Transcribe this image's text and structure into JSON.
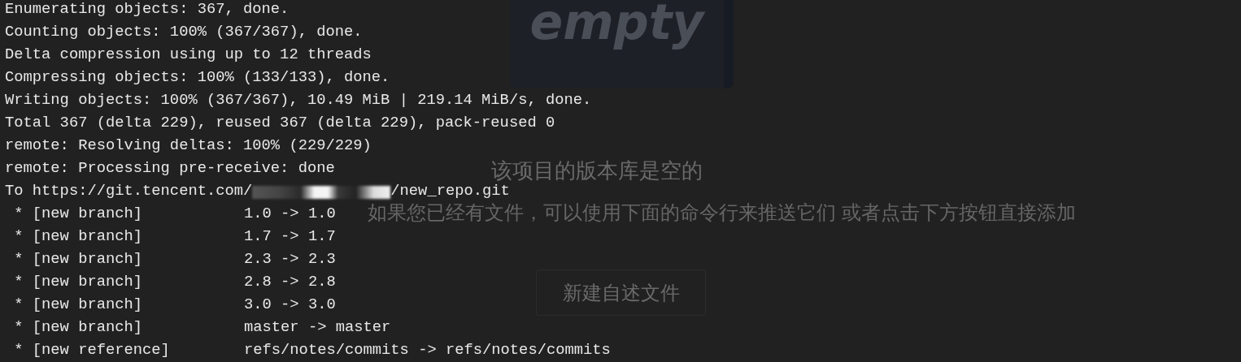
{
  "page": {
    "illustration_text": "empty",
    "title": "该项目的版本库是空的",
    "subtitle": "如果您已经有文件，可以使用下面的命令行来推送它们 或者点击下方按钮直接添加",
    "button": "新建自述文件"
  },
  "terminal": {
    "lines": [
      {
        "kind": "plain",
        "text": "Enumerating objects: 367, done."
      },
      {
        "kind": "plain",
        "text": "Counting objects: 100% (367/367), done."
      },
      {
        "kind": "plain",
        "text": "Delta compression using up to 12 threads"
      },
      {
        "kind": "plain",
        "text": "Compressing objects: 100% (133/133), done."
      },
      {
        "kind": "plain",
        "text": "Writing objects: 100% (367/367), 10.49 MiB | 219.14 MiB/s, done."
      },
      {
        "kind": "plain",
        "text": "Total 367 (delta 229), reused 367 (delta 229), pack-reused 0"
      },
      {
        "kind": "plain",
        "text": "remote: Resolving deltas: 100% (229/229)"
      },
      {
        "kind": "plain",
        "text": "remote: Processing pre-receive: done"
      },
      {
        "kind": "redacted",
        "before": "To https://git.tencent.com/",
        "after": "/new_repo.git"
      },
      {
        "kind": "ref",
        "status": " * [new branch]",
        "mapping": "1.0 -> 1.0"
      },
      {
        "kind": "ref",
        "status": " * [new branch]",
        "mapping": "1.7 -> 1.7"
      },
      {
        "kind": "ref",
        "status": " * [new branch]",
        "mapping": "2.3 -> 2.3"
      },
      {
        "kind": "ref",
        "status": " * [new branch]",
        "mapping": "2.8 -> 2.8"
      },
      {
        "kind": "ref",
        "status": " * [new branch]",
        "mapping": "3.0 -> 3.0"
      },
      {
        "kind": "ref",
        "status": " * [new branch]",
        "mapping": "master -> master"
      },
      {
        "kind": "ref",
        "status": " * [new reference]",
        "mapping": "refs/notes/commits -> refs/notes/commits"
      }
    ]
  }
}
